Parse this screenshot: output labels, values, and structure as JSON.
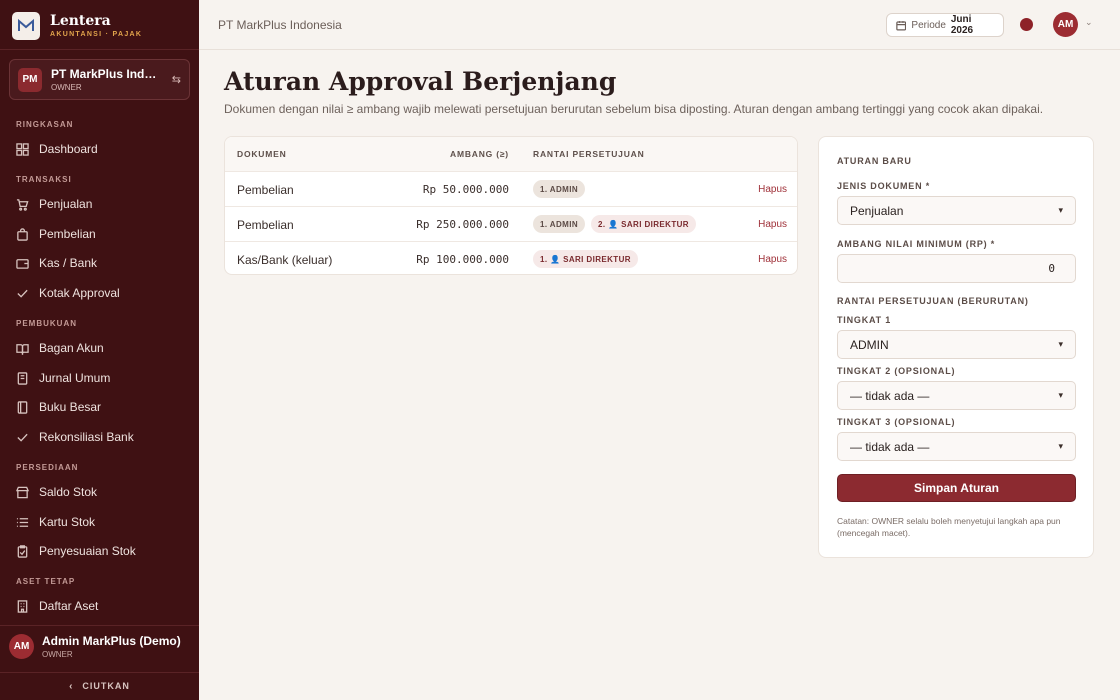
{
  "brand": {
    "name": "Lentera",
    "subtitle": "AKUNTANSI · PAJAK"
  },
  "org": {
    "initials": "PM",
    "name": "PT MarkPlus Indonesia",
    "role": "OWNER"
  },
  "nav": {
    "ringkasan": "RINGKASAN",
    "dashboard": "Dashboard",
    "transaksi": "TRANSAKSI",
    "penjualan": "Penjualan",
    "pembelian": "Pembelian",
    "kas_bank": "Kas / Bank",
    "kotak_approval": "Kotak Approval",
    "pembukuan": "PEMBUKUAN",
    "bagan_akun": "Bagan Akun",
    "jurnal_umum": "Jurnal Umum",
    "buku_besar": "Buku Besar",
    "rekonsiliasi_bank": "Rekonsiliasi Bank",
    "persediaan": "PERSEDIAAN",
    "saldo_stok": "Saldo Stok",
    "kartu_stok": "Kartu Stok",
    "penyesuaian_stok": "Penyesuaian Stok",
    "aset_tetap": "ASET TETAP",
    "daftar_aset": "Daftar Aset"
  },
  "user": {
    "initials": "AM",
    "name": "Admin MarkPlus (Demo)",
    "role": "OWNER"
  },
  "collapse_label": "CIUTKAN",
  "topbar": {
    "company": "PT MarkPlus Indonesia",
    "period_label": "Periode",
    "period_value": "Juni 2026",
    "avatar": "AM",
    "status_color": "#8e2228"
  },
  "page": {
    "title": "Aturan Approval Berjenjang",
    "description": "Dokumen dengan nilai ≥ ambang wajib melewati persetujuan berurutan sebelum bisa diposting. Aturan dengan ambang tertinggi yang cocok akan dipakai."
  },
  "table": {
    "headers": {
      "document": "DOKUMEN",
      "threshold": "AMBANG (≥)",
      "chain": "RANTAI PERSETUJUAN"
    },
    "delete_label": "Hapus",
    "rows": [
      {
        "document": "Pembelian",
        "amount": "Rp 50.000.000",
        "step1": "1. ADMIN",
        "step2": ""
      },
      {
        "document": "Pembelian",
        "amount": "Rp 250.000.000",
        "step1": "1. ADMIN",
        "step2": "2. 👤 SARI DIREKTUR"
      },
      {
        "document": "Kas/Bank (keluar)",
        "amount": "Rp 100.000.000",
        "step1": "1. 👤 SARI DIREKTUR",
        "step2": ""
      }
    ]
  },
  "form": {
    "title": "ATURAN BARU",
    "doc_type_label": "JENIS DOKUMEN *",
    "doc_type_value": "Penjualan",
    "threshold_label": "AMBANG NILAI MINIMUM (RP) *",
    "threshold_value": "0",
    "chain_label": "RANTAI PERSETUJUAN (BERURUTAN)",
    "level1_label": "TINGKAT 1",
    "level1_value": "ADMIN",
    "level2_label": "TINGKAT 2 (OPSIONAL)",
    "level2_value": "— tidak ada —",
    "level3_label": "TINGKAT 3 (OPSIONAL)",
    "level3_value": "— tidak ada —",
    "save_label": "Simpan Aturan",
    "note": "Catatan: OWNER selalu boleh menyetujui langkah apa pun (mencegah macet)."
  },
  "colors": {
    "sidebar": "#3f1113",
    "accent": "#8c2a30",
    "background": "#f7f3ef"
  }
}
